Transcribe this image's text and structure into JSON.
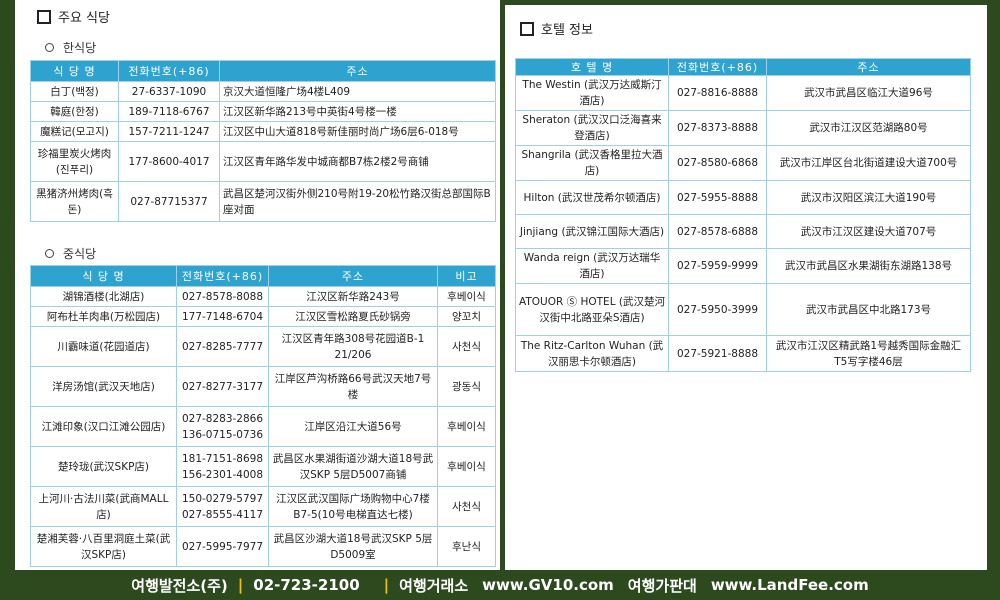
{
  "main_restaurants": {
    "title": "주요 식당",
    "korean": {
      "subtitle": "한식당",
      "headers": [
        "식 당 명",
        "전화번호(+86)",
        "주소"
      ],
      "rows": [
        {
          "name": "白丁(백정)",
          "phone": "27-6337-1090",
          "address": "京汉大道恒隆广场4楼L409"
        },
        {
          "name": "韓庭(한정)",
          "phone": "189-7118-6767",
          "address": "江汉区新华路213号中英街4号楼一楼"
        },
        {
          "name": "魔糕记(모고지)",
          "phone": "157-7211-1247",
          "address": "江汉区中山大道818号新佳丽时尚广场6层6-018号"
        },
        {
          "name": "珍福里炭火烤肉(진푸리)",
          "phone": "177-8600-4017",
          "address": "江汉区青年路华发中城商都B7栋2楼2号商铺"
        },
        {
          "name": "黑猪济州烤肉(흑돈)",
          "phone": "027-87715377",
          "address": "武昌区楚河汉街外侧210号附19-20松竹路汉街总部国际B座对面"
        }
      ]
    },
    "chinese": {
      "subtitle": "중식당",
      "headers": [
        "식 당 명",
        "전화번호(+86)",
        "주소",
        "비고"
      ],
      "rows": [
        {
          "name": "湖锦酒楼(北湖店)",
          "phone": "027-8578-8088",
          "address": "江汉区新华路243号",
          "note": "후베이식"
        },
        {
          "name": "阿布杜羊肉串(万松园店)",
          "phone": "177-7148-6704",
          "address": "江汉区雪松路夏氏砂锅旁",
          "note": "양꼬치"
        },
        {
          "name": "川霸味道(花园道店)",
          "phone": "027-8285-7777",
          "address": "江汉区青年路308号花园道B-1 21/206",
          "note": "사천식"
        },
        {
          "name": "洋房汤馆(武汉天地店)",
          "phone": "027-8277-3177",
          "address": "江岸区芦沟桥路66号武汉天地7号楼",
          "note": "광동식"
        },
        {
          "name": "江滩印象(汉口江滩公园店)",
          "phone": "027-8283-2866 136-0715-0736",
          "address": "江岸区沿江大道56号",
          "note": "후베이식"
        },
        {
          "name": "楚玲珑(武汉SKP店)",
          "phone": "181-7151-8698 156-2301-4008",
          "address": "武昌区水果湖街道沙湖大道18号武汉SKP 5层D5007商铺",
          "note": "후베이식"
        },
        {
          "name": "上河川·古法川菜(武商MALL店)",
          "phone": "150-0279-5797 027-8555-4117",
          "address": "江汉区武汉国际广场购物中心7楼B7-5(10号电梯直达七楼)",
          "note": "사천식"
        },
        {
          "name": "楚湘芙蓉·八百里洞庭土菜(武汉SKP店)",
          "phone": "027-5995-7977",
          "address": "武昌区沙湖大道18号武汉SKP 5层D5009室",
          "note": "후난식"
        }
      ]
    }
  },
  "hotels": {
    "title": "호텔 정보",
    "headers": [
      "호 텔 명",
      "전화번호(+86)",
      "주소"
    ],
    "rows": [
      {
        "name": "The Westin (武汉万达威斯汀酒店)",
        "phone": "027-8816-8888",
        "address": "武汉市武昌区临江大道96号"
      },
      {
        "name": "Sheraton (武汉汉口泛海喜来登酒店)",
        "phone": "027-8373-8888",
        "address": "武汉市江汉区范湖路80号"
      },
      {
        "name": "Shangrila (武汉香格里拉大酒店)",
        "phone": "027-8580-6868",
        "address": "武汉市江岸区台北街道建设大道700号"
      },
      {
        "name": "Hilton (武汉世茂希尔顿酒店)",
        "phone": "027-5955-8888",
        "address": "武汉市汉阳区滨江大道190号"
      },
      {
        "name": "Jinjiang (武汉锦江国际大酒店)",
        "phone": "027-8578-6888",
        "address": "武汉市江汉区建设大道707号"
      },
      {
        "name": "Wanda reign (武汉万达瑞华酒店)",
        "phone": "027-5959-9999",
        "address": "武汉市武昌区水果湖街东湖路138号"
      },
      {
        "name": "ATOUOR Ⓢ HOTEL (武汉楚河汉街中北路亚朵S酒店)",
        "phone": "027-5950-3999",
        "address": "武汉市武昌区中北路173号"
      },
      {
        "name": "The Ritz-Carlton Wuhan (武汉丽思卡尔顿酒店)",
        "phone": "027-5921-8888",
        "address": "武汉市江汉区精武路1号越秀国际金融汇T5写字楼46层"
      }
    ]
  },
  "footer": {
    "agency": "여행발전소(주)",
    "phone": "02-723-2100",
    "exchange_label": "여행거래소",
    "exchange_url": "www.GV10.com",
    "price_label": "여행가판대",
    "price_url": "www.LandFee.com",
    "separator": "|"
  }
}
